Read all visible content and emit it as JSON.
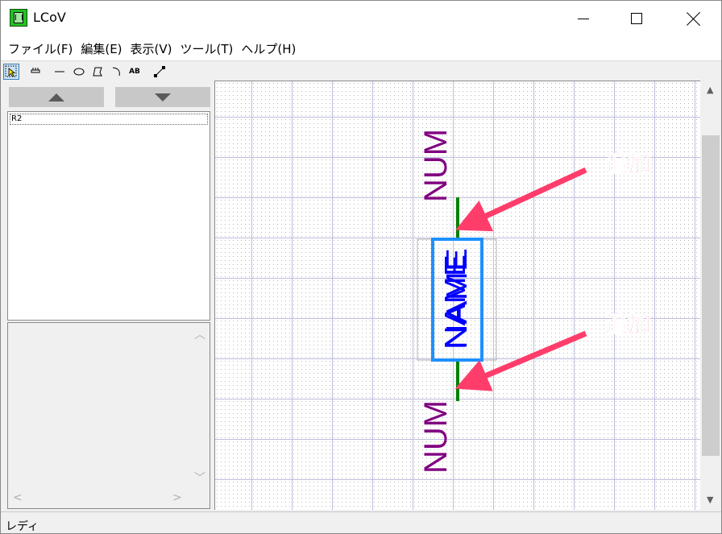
{
  "window": {
    "title": "LCoV"
  },
  "menu": [
    {
      "label": "ファイル(F)"
    },
    {
      "label": "編集(E)"
    },
    {
      "label": "表示(V)"
    },
    {
      "label": "ツール(T)"
    },
    {
      "label": "ヘルプ(H)"
    }
  ],
  "toolbar": {
    "tools": [
      "select-tool",
      "pin-tool",
      "line-tool",
      "ellipse-tool",
      "polygon-tool",
      "arc-tool",
      "text-tool",
      "connect-tool"
    ],
    "text_tool_label": "AB"
  },
  "part_list": {
    "items": [
      "R2"
    ]
  },
  "canvas": {
    "upper_label": "NUM",
    "lower_label": "NUM",
    "body_label_1": "NAME",
    "body_label_2": "NAME",
    "annotation_top": "追加",
    "annotation_bottom": "追加",
    "colors": {
      "pin": "#008000",
      "body": "#1e90ff",
      "label": "#800080",
      "name": "#0000ff",
      "annotation": "#ff3d6b"
    }
  },
  "status": {
    "text": "レディ"
  }
}
